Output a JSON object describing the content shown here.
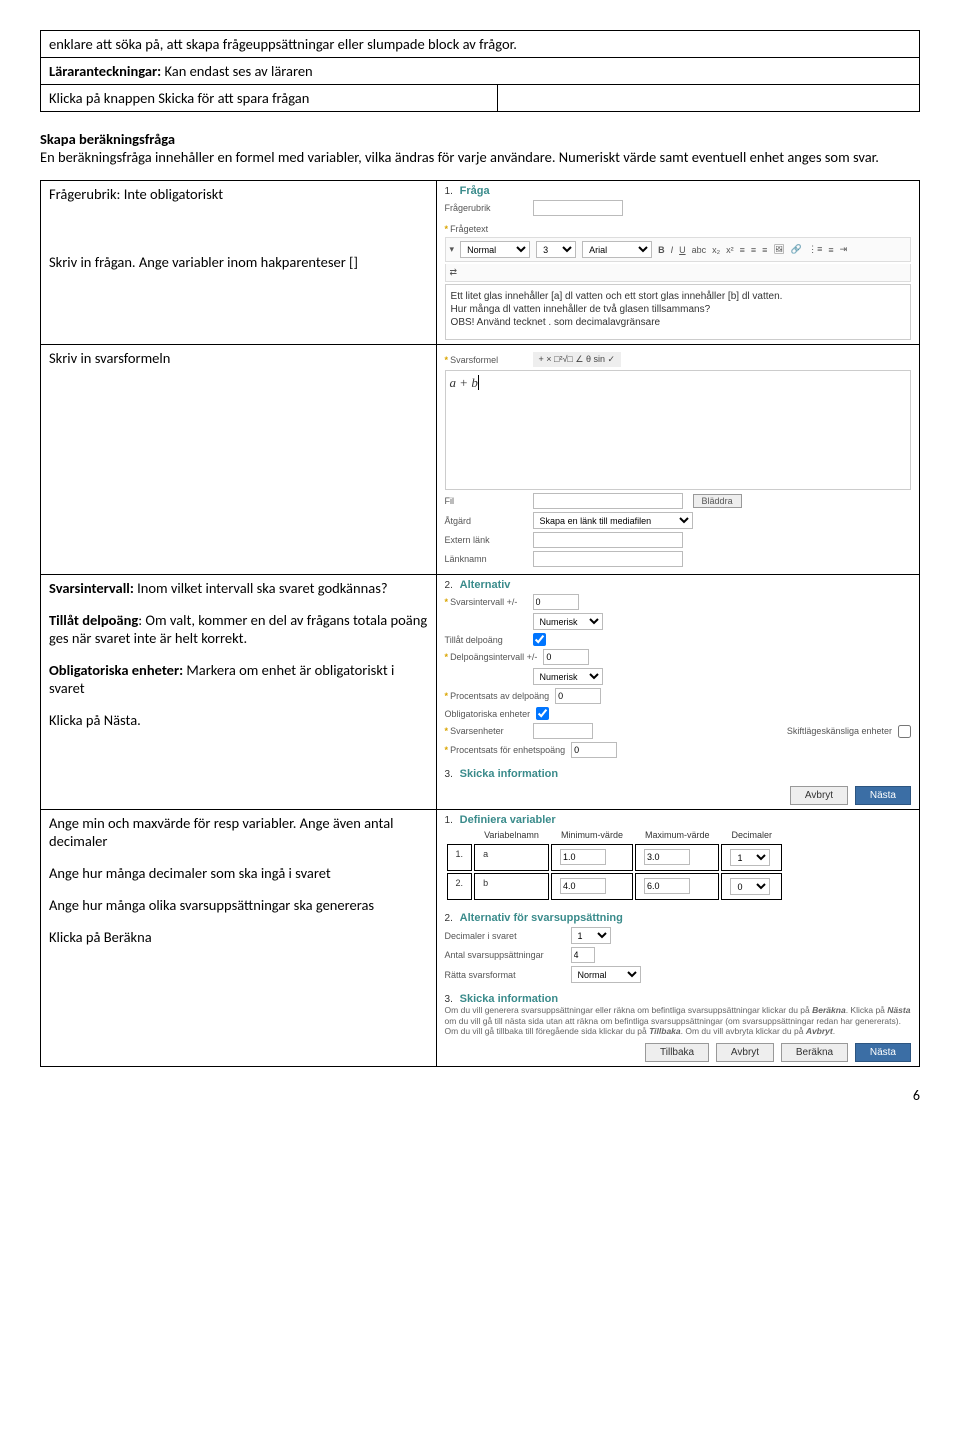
{
  "topbox": {
    "line1": "enklare att söka på, att skapa frågeuppsättningar eller slumpade block av frågor.",
    "line2b": "Läraranteckningar:",
    "line2": " Kan endast ses av läraren",
    "line3": "Klicka på knappen Skicka för att spara frågan"
  },
  "intro": {
    "title": "Skapa beräkningsfråga",
    "body": "En beräkningsfråga innehåller en formel med variabler, vilka ändras för varje användare. Numeriskt värde samt eventuell enhet anges som svar."
  },
  "row1": {
    "left1": "Frågerubrik: Inte obligatoriskt",
    "left2": "Skriv in frågan. Ange variabler inom hakparenteser []",
    "right": {
      "num": "1.",
      "head": "Fråga",
      "lblRubrik": "Frågerubrik",
      "lblText": "Frågetext",
      "tbNormal": "Normal",
      "tbSize": "3",
      "tbFont": "Arial",
      "rte1": "Ett litet glas innehåller [a] dl vatten och ett stort glas innehåller [b] dl vatten.",
      "rte2": "Hur många dl vatten innehåller de två glasen tillsammans?",
      "rte3": "OBS! Använd tecknet . som decimalavgränsare"
    }
  },
  "row2": {
    "left": "Skriv in svarsformeln",
    "right": {
      "lbl": "Svarsformel",
      "ops": "+  ×     □²√□     ∠ θ sin     ✓",
      "formula": "a + b",
      "fil": "Fil",
      "bladdra": "Bläddra",
      "atgard": "Åtgärd",
      "atgardVal": "Skapa en länk till mediafilen",
      "extern": "Extern länk",
      "lanknamn": "Länknamn"
    }
  },
  "row3": {
    "left1b": "Svarsintervall:",
    "left1": " Inom vilket intervall ska svaret godkännas?",
    "left2b": "Tillåt delpoäng",
    "left2": ": Om valt, kommer en del av frågans totala poäng ges när svaret inte är helt korrekt.",
    "left3b": "Obligatoriska enheter:",
    "left3": " Markera om enhet är obligatoriskt i svaret",
    "left4": "Klicka på Nästa.",
    "right": {
      "num": "2.",
      "head": "Alternativ",
      "svInterval": "Svarsintervall +/-",
      "zero": "0",
      "numerisk": "Numerisk",
      "tillat": "Tillåt delpoäng",
      "delInterval": "Delpoängsintervall +/-",
      "procDel": "Procentsats av delpoäng",
      "oblig": "Obligatoriska enheter",
      "svEnh": "Svarsenheter",
      "skift": "Skiftlägeskänsliga enheter",
      "procEnh": "Procentsats för enhetspoäng",
      "num3": "3.",
      "head3": "Skicka information",
      "avbryt": "Avbryt",
      "nasta": "Nästa"
    }
  },
  "row4": {
    "left1": "Ange min och maxvärde för resp variabler. Ange även antal decimaler",
    "left2": "Ange hur många decimaler som ska ingå i svaret",
    "left3": "Ange hur många olika svarsuppsättningar ska genereras",
    "left4": "Klicka på Beräkna",
    "right": {
      "num1": "1.",
      "head1": "Definiera variabler",
      "thVar": "Variabelnamn",
      "thMin": "Minimum-värde",
      "thMax": "Maximum-värde",
      "thDec": "Decimaler",
      "r1n": "1.",
      "r1v": "a",
      "r1min": "1.0",
      "r1max": "3.0",
      "r1dec": "1",
      "r2n": "2.",
      "r2v": "b",
      "r2min": "4.0",
      "r2max": "6.0",
      "r2dec": "0",
      "num2": "2.",
      "head2": "Alternativ för svarsuppsättning",
      "decSvar": "Decimaler i svaret",
      "decSvarVal": "1",
      "antal": "Antal svarsuppsättningar",
      "antalVal": "4",
      "ratta": "Rätta svarsformat",
      "rattaVal": "Normal",
      "num3": "3.",
      "head3": "Skicka information",
      "info1": "Om du vill generera svarsuppsättningar eller räkna om befintliga svarsuppsättningar klickar du på ",
      "info1b": "Beräkna",
      "info1c": ". Klicka på ",
      "info1d": "Nästa",
      "info2": " om du vill gå till nästa sida utan att räkna om befintliga svarsuppsättningar (om svarsuppsättningar redan har genererats). Om du vill gå tillbaka till föregående sida klickar du på ",
      "info2b": "Tillbaka",
      "info2c": ". Om du vill avbryta klickar du på ",
      "info2d": "Avbryt",
      "info2e": ".",
      "tillbaka": "Tillbaka",
      "avbryt": "Avbryt",
      "berakna": "Beräkna",
      "nasta": "Nästa"
    }
  },
  "pagenum": "6"
}
